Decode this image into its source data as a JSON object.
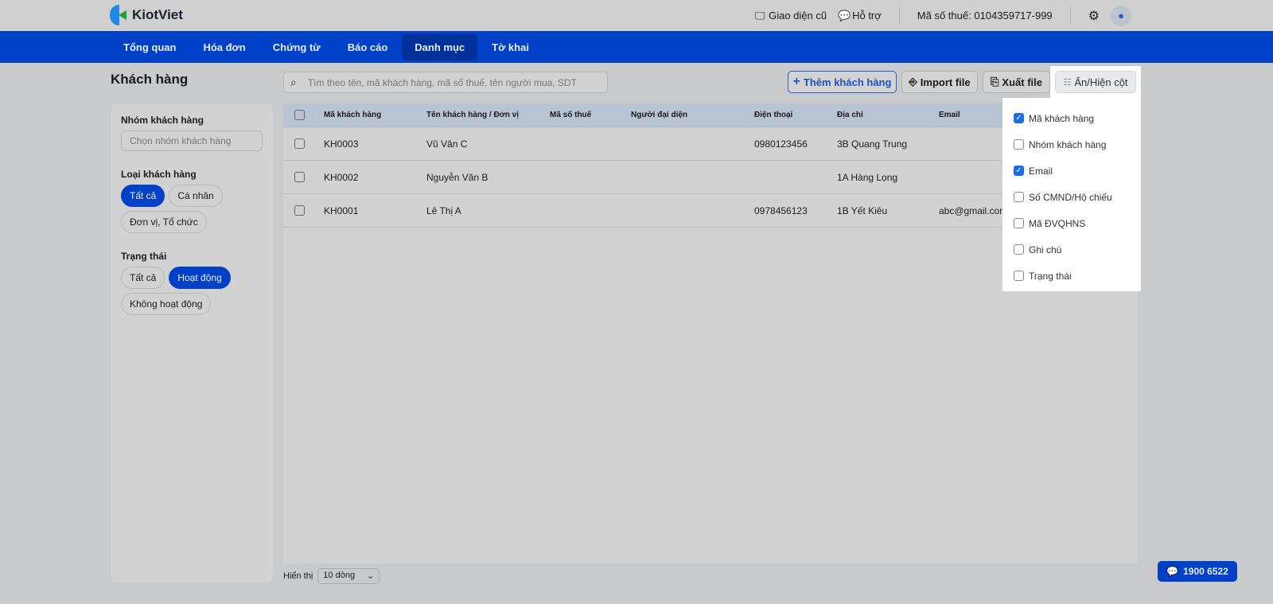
{
  "app": {
    "name": "KiotViet"
  },
  "topbar": {
    "old_ui": "Giao diện cũ",
    "support": "Hỗ trợ",
    "tax_code": "Mã số thuế: 0104359717-999"
  },
  "nav": [
    "Tổng quan",
    "Hóa đơn",
    "Chứng từ",
    "Báo cáo",
    "Danh mục",
    "Tờ khai"
  ],
  "page": {
    "title": "Khách hàng",
    "search_placeholder": "Tìm theo tên, mã khách hàng, mã số thuế, tên người mua, SDT"
  },
  "actions": {
    "add": "Thêm khách hàng",
    "import": "Import file",
    "export": "Xuất file",
    "columns": "Ẩn/Hiện cột"
  },
  "filters": {
    "group_label": "Nhóm khách hàng",
    "group_placeholder": "Chọn nhóm khách hàng",
    "type_label": "Loại khách hàng",
    "type_options": [
      "Tất cả",
      "Cá nhân",
      "Đơn vị, Tổ chức"
    ],
    "type_selected": "Tất cả",
    "status_label": "Trạng thái",
    "status_options": [
      "Tất cả",
      "Hoạt động",
      "Không hoạt động"
    ],
    "status_selected": "Hoạt động"
  },
  "table": {
    "headers": [
      "Mã khách hàng",
      "Tên khách hàng / Đơn vị",
      "Mã số thuế",
      "Người đại diện",
      "Điện thoại",
      "Địa chỉ",
      "Email"
    ],
    "rows": [
      [
        "KH0003",
        "Vũ Văn C",
        "",
        "",
        "0980123456",
        "3B Quang Trung",
        ""
      ],
      [
        "KH0002",
        "Nguyễn Văn B",
        "",
        "",
        "",
        "1A Hàng Lọng",
        ""
      ],
      [
        "KH0001",
        "Lê Thị A",
        "",
        "",
        "0978456123",
        "1B Yết Kiêu",
        "abc@gmail.com"
      ]
    ]
  },
  "footer": {
    "show_label": "Hiển thị",
    "page_size": "10 dòng"
  },
  "hotline": "1900 6522",
  "column_menu": [
    {
      "label": "Mã khách hàng",
      "checked": true
    },
    {
      "label": "Nhóm khách hàng",
      "checked": false
    },
    {
      "label": "Email",
      "checked": true
    },
    {
      "label": "Số CMND/Hộ chiếu",
      "checked": false
    },
    {
      "label": "Mã ĐVQHNS",
      "checked": false
    },
    {
      "label": "Ghi chú",
      "checked": false
    },
    {
      "label": "Trạng thái",
      "checked": false
    }
  ],
  "colors": {
    "primary": "#0041c8",
    "nav_active": "#00319a",
    "checkbox": "#1a6ee8"
  }
}
